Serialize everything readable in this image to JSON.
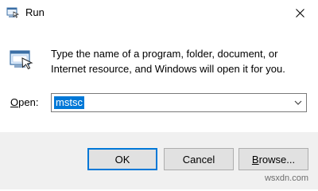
{
  "window": {
    "title": "Run",
    "app_icon": "run-icon",
    "close_icon": "close-icon"
  },
  "body": {
    "description": "Type the name of a program, folder, document, or Internet resource, and Windows will open it for you.",
    "big_icon": "run-icon"
  },
  "open_field": {
    "label_prefix": "",
    "label_underlined": "O",
    "label_suffix": "pen:",
    "value": "mstsc",
    "arrow_icon": "chevron-down-icon"
  },
  "buttons": {
    "ok": "OK",
    "cancel": "Cancel",
    "browse_prefix": "",
    "browse_underlined": "B",
    "browse_suffix": "rowse..."
  },
  "watermark": "wsxdn.com",
  "colors": {
    "accent": "#0078d7",
    "footer_bg": "#f0f0f0",
    "button_bg": "#e1e1e1"
  }
}
